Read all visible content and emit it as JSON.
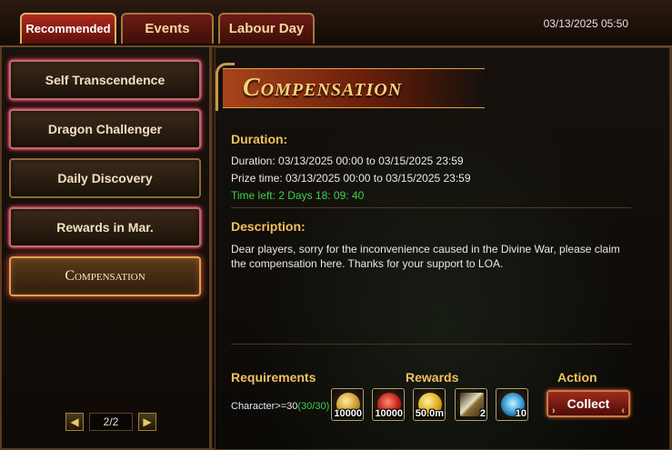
{
  "tabs": [
    {
      "label": "Recommended",
      "active": true
    },
    {
      "label": "Events",
      "active": false
    },
    {
      "label": "Labour Day",
      "active": false
    }
  ],
  "datetime": "03/13/2025 05:50",
  "sidebar": {
    "items": [
      {
        "label": "Self Transcendence"
      },
      {
        "label": "Dragon Challenger"
      },
      {
        "label": "Daily Discovery"
      },
      {
        "label": "Rewards in Mar."
      },
      {
        "label": "Compensation"
      }
    ],
    "pager": {
      "text": "2/2",
      "prev_icon": "left-arrow-icon",
      "next_icon": "right-arrow-icon"
    }
  },
  "main": {
    "title": "Compensation",
    "duration_heading": "Duration:",
    "duration_line": "Duration: 03/13/2025 00:00 to 03/15/2025 23:59",
    "prize_line": "Prize time: 03/13/2025 00:00 to 03/15/2025 23:59",
    "time_left": "Time left: 2 Days  18: 09: 40",
    "description_heading": "Description:",
    "description": "Dear players, sorry for the inconvenience caused in the Divine War, please claim the compensation here. Thanks for your support to LOA.",
    "requirements_heading": "Requirements",
    "rewards_heading": "Rewards",
    "action_heading": "Action",
    "requirement_text": "Character>=30",
    "requirement_progress": "(30/30)",
    "rewards": [
      {
        "qty": "10000",
        "icon": "gold-coin-icon"
      },
      {
        "qty": "10000",
        "icon": "red-gem-icon"
      },
      {
        "qty": "50.0m",
        "icon": "gold-medal-icon"
      },
      {
        "qty": "2",
        "icon": "crossed-swords-icon"
      },
      {
        "qty": "10",
        "icon": "blue-crystal-icon"
      }
    ],
    "collect_label": "Collect"
  }
}
